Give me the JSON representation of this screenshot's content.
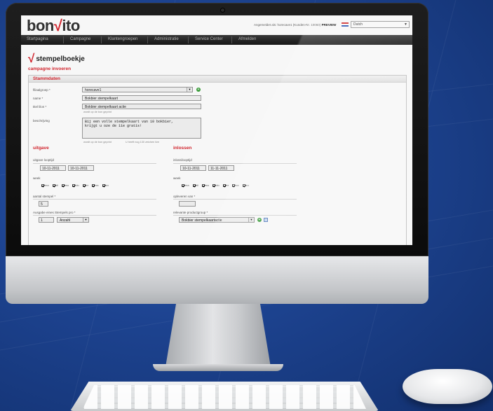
{
  "brand": {
    "logo_left": "bon",
    "logo_mark": "√",
    "logo_right": "ito"
  },
  "header": {
    "login_text": "Angemeldet als: horecave1 (Kunden-Nr. 10060)",
    "preview_label": "PREVIEW",
    "language": "Dutch"
  },
  "nav": {
    "items": [
      "Startpagina",
      "Campagne",
      "Klantengroepen",
      "Administratie",
      "Service Center",
      "Afmelden"
    ]
  },
  "page": {
    "title": "stempelboekje",
    "subtitle": "campagne invoeren"
  },
  "stammdaten": {
    "heading": "Stammdaten",
    "filiaalgroep_label": "filiaalgroep *",
    "filiaalgroep_value": "horecave1",
    "name_label": "name *",
    "name_value": "Bokbier stempelkaart",
    "titel_label": "titel lilon *",
    "titel_value": "Bokbier stempelkaart actie",
    "titel_hint": "wordt op de bon geprint",
    "beschrijving_label": "beschrijving",
    "beschrijving_line1": "Bij een volle stempelkaart van 10 bokbier,",
    "beschrijving_line2": "krijgt u oze de 11e gratis!",
    "beschrijving_hint1": "wordt op de bon geprint",
    "beschrijving_hint2": "U heeft nog 130 zeichen live"
  },
  "uitgave": {
    "heading": "uitgave",
    "looptijd_label": "uitgave looptijd",
    "date_from": "10-11-2011",
    "date_to": "10-11-2011",
    "week_label": "week",
    "days": [
      "ma",
      "di",
      "wo",
      "do",
      "vr",
      "za",
      "zo"
    ],
    "aantal_label": "aantal stempel *",
    "aantal_value": "5",
    "ausgabe_label": "Ausgabe eines Stempels pro *",
    "ausgabe_qty": "1",
    "ausgabe_unit": "Anzahl"
  },
  "inlossen": {
    "heading": "inlossen",
    "looptijd_label": "inlossilooptijd",
    "date_from": "10-11-2011",
    "date_to": "11-11-2011",
    "week_label": "week",
    "days": [
      "ma",
      "di",
      "wo",
      "do",
      "vr",
      "za",
      "zo"
    ],
    "opleveren_label": "opleveren van *",
    "productgroup_label": "relevante productgroup *",
    "productgroup_value": "Bokbier stempelkaartactie"
  }
}
